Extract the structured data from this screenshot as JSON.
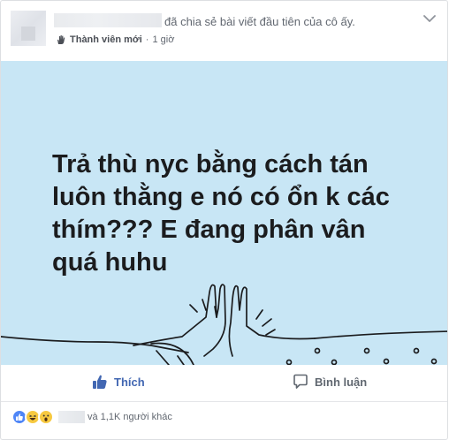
{
  "header": {
    "shared_text": "đã chia sẻ bài viết đầu tiên của cô ấy.",
    "badge_label": "Thành viên mới",
    "badge_separator": "·",
    "timestamp": "1 giờ",
    "more_icon": "more-options-icon"
  },
  "post_image": {
    "text": "Trả thù nyc bằng cách tán luôn thằng e nó có ổn k các thím??? E đang phân vân quá huhu",
    "background_color": "#c8e6f5",
    "illustration": "high-five-hands"
  },
  "actions": {
    "like_label": "Thích",
    "comment_label": "Bình luận",
    "like_color": "#4267b2"
  },
  "reactions": {
    "icons": [
      "like-reaction-icon",
      "haha-reaction-icon",
      "wow-reaction-icon"
    ],
    "summary_text": "và 1,1K người khác"
  }
}
